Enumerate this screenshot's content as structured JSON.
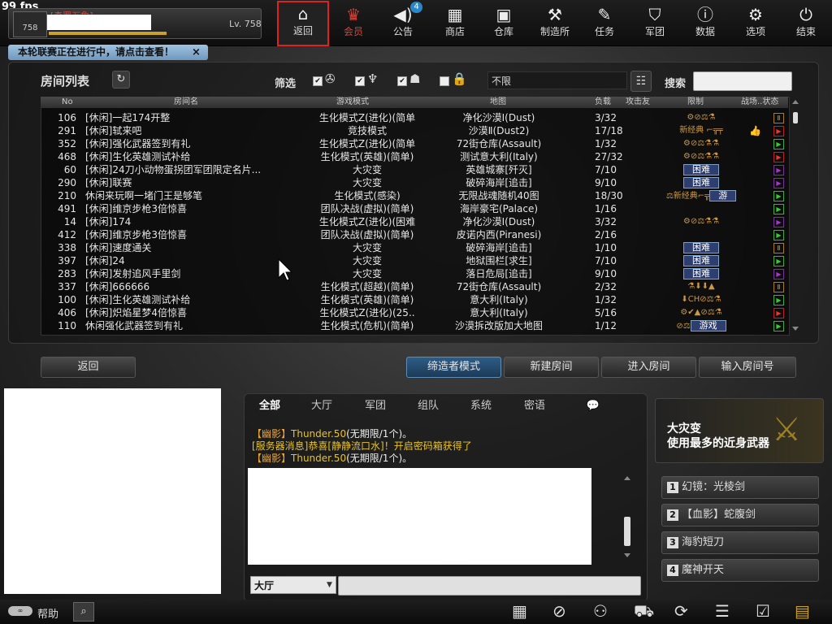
{
  "fps": "99 fps",
  "profile": {
    "title": "[森罗万象]",
    "rank_badge": "758",
    "level": "Lv. 758",
    "xp_progress": 0.57
  },
  "nav": [
    {
      "label": "返回",
      "icon": "home-icon",
      "glyph": "⌂"
    },
    {
      "label": "会员",
      "icon": "crown-icon",
      "glyph": "♛"
    },
    {
      "label": "公告",
      "icon": "megaphone-icon",
      "glyph": "📢"
    },
    {
      "label": "商店",
      "icon": "shop-icon",
      "glyph": "▦"
    },
    {
      "label": "仓库",
      "icon": "briefcase-icon",
      "glyph": "▣"
    },
    {
      "label": "制造所",
      "icon": "gun-icon",
      "glyph": "⚒"
    },
    {
      "label": "任务",
      "icon": "ticket-icon",
      "glyph": "✎"
    },
    {
      "label": "军团",
      "icon": "shield-icon",
      "glyph": "⛉"
    },
    {
      "label": "数据",
      "icon": "alert-icon",
      "glyph": "ⓘ"
    },
    {
      "label": "选项",
      "icon": "gear-icon",
      "glyph": "⚙"
    },
    {
      "label": "结束",
      "icon": "power-icon",
      "glyph": "⏻"
    }
  ],
  "announce_badge": "4",
  "notice": "本轮联赛正在进行中，请点击查看！",
  "notice_close": "×",
  "room_panel": {
    "title": "房间列表",
    "refresh_glyph": "↻",
    "filter_label": "筛选",
    "filter_value": "不限",
    "filter_settings_glyph": "☷",
    "search_label": "搜索",
    "columns": [
      "No",
      "房间名",
      "游戏模式",
      "地图",
      "负载",
      "攻击友",
      "限制",
      "战场..状态"
    ],
    "rows": [
      {
        "no": "106",
        "name": "[休闲]一起174开整",
        "mode": "生化模式Z(进化)(简单",
        "map": "净化沙漠Ⅰ(Dust)",
        "load": "3/32",
        "limit": "⚙⊘⚖⚗",
        "tag": "",
        "status": "pause",
        "thumb": ""
      },
      {
        "no": "291",
        "name": "[休闲]轼来吧",
        "mode": "竞技模式",
        "map": "沙漠Ⅱ(Dust2)",
        "load": "17/18",
        "limit": "新经典 ⌐╦╤",
        "tag": "",
        "status": "red",
        "thumb": "👍"
      },
      {
        "no": "352",
        "name": "[休闲]强化武器签到有礼",
        "mode": "生化模式Z(进化)(简单",
        "map": "72街仓库(Assault)",
        "load": "1/32",
        "limit": "⚙⊘⚖⚗⚗",
        "tag": "",
        "status": "play",
        "thumb": ""
      },
      {
        "no": "468",
        "name": "[休闲]生化英雄测试补给",
        "mode": "生化模式(英雄)(简单)",
        "map": "测试意大利(Italy)",
        "load": "27/32",
        "limit": "⚙⊘⚖⚗⚗",
        "tag": "",
        "status": "red",
        "thumb": ""
      },
      {
        "no": "60",
        "name": "[休闲]24刀小动物蛋拐团军团限定名片...",
        "mode": "大灾变",
        "map": "英雄城寨[歼灭]",
        "load": "7/10",
        "limit": "",
        "tag": "困难",
        "status": "purple",
        "thumb": ""
      },
      {
        "no": "290",
        "name": "[休闲]联赛",
        "mode": "大灾变",
        "map": "破碎海岸[追击]",
        "load": "9/10",
        "limit": "",
        "tag": "困难",
        "status": "purple",
        "thumb": ""
      },
      {
        "no": "210",
        "name": "休闲来玩啊一堵门王是够笔",
        "mode": "生化模式(感染)",
        "map": "无限战魂随机40图",
        "load": "18/30",
        "limit": "⚖新经典⌐╦",
        "tag": "游",
        "status": "play",
        "thumb": ""
      },
      {
        "no": "491",
        "name": "[休闲]维京步枪3倍惊喜",
        "mode": "团队决战(虚拟)(简单)",
        "map": "海岸豪宅(Palace)",
        "load": "1/16",
        "limit": "",
        "tag": "",
        "status": "play",
        "thumb": ""
      },
      {
        "no": "14",
        "name": "[休闲]174",
        "mode": "生化模式Z(进化)(困难",
        "map": "净化沙漠Ⅰ(Dust)",
        "load": "3/32",
        "limit": "⚙⊘⚖⚗⚗",
        "tag": "",
        "status": "purple",
        "thumb": ""
      },
      {
        "no": "412",
        "name": "[休闲]维京步枪3倍惊喜",
        "mode": "团队决战(虚拟)(简单)",
        "map": "皮诺内西(Piranesi)",
        "load": "2/16",
        "limit": "",
        "tag": "",
        "status": "play",
        "thumb": ""
      },
      {
        "no": "338",
        "name": "[休闲]速度通关",
        "mode": "大灾变",
        "map": "破碎海岸[追击]",
        "load": "1/10",
        "limit": "",
        "tag": "困难",
        "status": "pause",
        "thumb": ""
      },
      {
        "no": "397",
        "name": "[休闲]24",
        "mode": "大灾变",
        "map": "地狱围栏[求生]",
        "load": "7/10",
        "limit": "",
        "tag": "困难",
        "status": "play",
        "thumb": ""
      },
      {
        "no": "283",
        "name": "[休闲]发射追风手里剑",
        "mode": "大灾变",
        "map": "落日危局[追击]",
        "load": "9/10",
        "limit": "",
        "tag": "困难",
        "status": "purple",
        "thumb": ""
      },
      {
        "no": "337",
        "name": "[休闲]666666",
        "mode": "生化模式(超越)(简单)",
        "map": "72街仓库(Assault)",
        "load": "2/32",
        "limit": "⚗⬇⬇▲",
        "tag": "",
        "status": "pause",
        "thumb": ""
      },
      {
        "no": "100",
        "name": "[休闲]生化英雄测试补给",
        "mode": "生化模式(英雄)(简单)",
        "map": "意大利(Italy)",
        "load": "1/32",
        "limit": "⬇CH⊘⚖⚗",
        "tag": "",
        "status": "play",
        "thumb": ""
      },
      {
        "no": "406",
        "name": "[休闲]炽焰星梦4倍惊喜",
        "mode": "生化模式Z(进化)(25..",
        "map": "意大利(Italy)",
        "load": "5/16",
        "limit": "⚙✔▲⊘⚖⚗",
        "tag": "",
        "status": "red",
        "thumb": ""
      },
      {
        "no": "110",
        "name": "休闲强化武器签到有礼",
        "mode": "生化模式(危机)(简单)",
        "map": "沙漠拆改版加大地图",
        "load": "1/12",
        "limit": "⊘⚖",
        "tag": "游戏",
        "status": "play",
        "thumb": ""
      }
    ]
  },
  "buttons": {
    "back": "返回",
    "creator": "缔造者模式",
    "new_room": "新建房间",
    "enter_room": "进入房间",
    "input_room": "输入房间号"
  },
  "chat": {
    "tabs": [
      "全部",
      "大厅",
      "军团",
      "组队",
      "系统",
      "密语",
      "💬"
    ],
    "messages": [
      {
        "prefix": "【幽影】",
        "text": "Thunder.50",
        "suffix": "(无期限/1个)。"
      },
      {
        "prefix": "[服务器消息]",
        "text": "恭喜[静静流口水]！开启密码箱获得了",
        "suffix": ""
      },
      {
        "prefix": "【幽影】",
        "text": "Thunder.50",
        "suffix": "(无期限/1个)。"
      }
    ],
    "channel": "大厅"
  },
  "weapon_panel": {
    "line1": "大灾变",
    "line2": "使用最多的近身武器",
    "ranks": [
      {
        "n": "1",
        "name": "幻镜：光棱剑"
      },
      {
        "n": "2",
        "name": "【血影】蛇腹剑"
      },
      {
        "n": "3",
        "name": "海豹短刀"
      },
      {
        "n": "4",
        "name": "魔神开天"
      }
    ]
  },
  "bottom": {
    "help": "帮助",
    "help_icon": "∞"
  }
}
